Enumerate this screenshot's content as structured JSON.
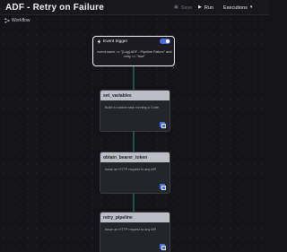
{
  "header": {
    "title": "ADF - Retry on Failure",
    "save_label": "Save",
    "run_label": "Run",
    "executions_label": "Executions"
  },
  "breadcrumb": {
    "label": "Workflow"
  },
  "trigger": {
    "title": "Event trigger",
    "condition": "event.name == \"[Log] ADF - Pipeline Failure\" and retry == \"true\"",
    "enabled": true
  },
  "nodes": [
    {
      "title": "set_variables",
      "description": "Build a custom task running a Code"
    },
    {
      "title": "obtain_bearer_token",
      "description": "Issue an HTTP request to any API"
    },
    {
      "title": "retry_pipeline",
      "description": "Issue an HTTP request to any API"
    }
  ],
  "colors": {
    "accent": "#4a6fe0",
    "edge": "#2f8a7c",
    "background": "#141418"
  }
}
